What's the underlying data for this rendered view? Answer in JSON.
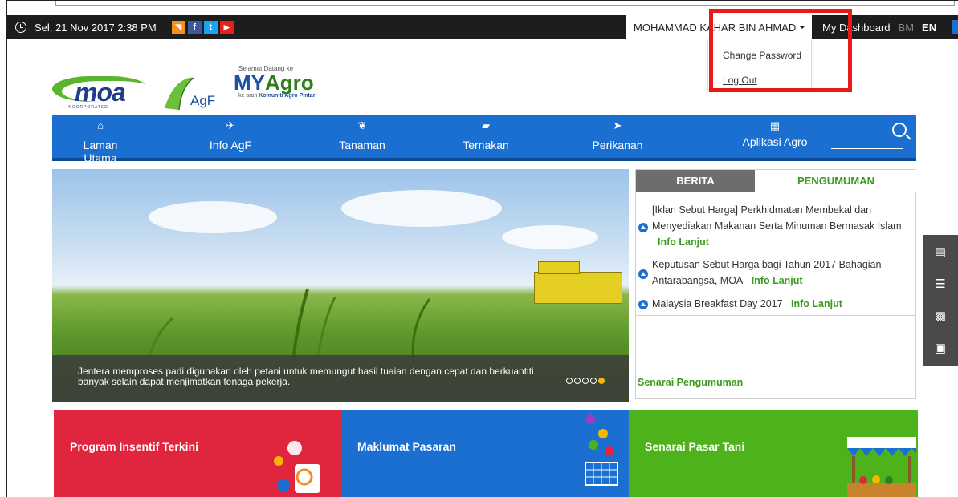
{
  "topbar": {
    "datetime": "Sel, 21 Nov 2017  2:38  PM",
    "social_icons": [
      "rss-icon",
      "facebook-icon",
      "twitter-icon",
      "youtube-icon"
    ],
    "user_name": "MOHAMMAD KAHAR BIN AHMAD",
    "dashboard": "My Dashboard",
    "lang_bm": "BM",
    "lang_en": "EN"
  },
  "user_menu": {
    "change_password": "Change Password",
    "log_out": "Log Out"
  },
  "logo": {
    "moa": "moa",
    "moa_sub": "INCORPORATED",
    "agf": "AgF",
    "welcome": "Selamat Datang ke",
    "brand_a": "MY",
    "brand_b": "Agro",
    "tagline_a": "ke arah ",
    "tagline_b": "Komuniti Agro Pintar"
  },
  "nav": {
    "items": [
      "Laman Utama",
      "Info AgF",
      "Tanaman",
      "Ternakan",
      "Perikanan",
      "Aplikasi Agro"
    ]
  },
  "hero": {
    "caption": "Jentera memproses padi digunakan oleh petani untuk memungut hasil tuaian dengan cepat dan berkuantiti banyak selain dapat menjimatkan tenaga pekerja.",
    "slides_total": 5,
    "active_slide": 5
  },
  "news": {
    "tab_berita": "BERITA",
    "tab_pengumuman": "PENGUMUMAN",
    "items": [
      {
        "text": "[Iklan Sebut Harga] Perkhidmatan Membekal dan Menyediakan Makanan Serta Minuman Bermasak Islam",
        "more": "Info Lanjut"
      },
      {
        "text": "Keputusan Sebut Harga bagi Tahun 2017 Bahagian Antarabangsa, MOA",
        "more": "Info Lanjut"
      },
      {
        "text": "Malaysia Breakfast Day 2017",
        "more": "Info Lanjut"
      }
    ],
    "list_link": "Senarai Pengumuman"
  },
  "side_tools": [
    "feedback-icon",
    "list-icon",
    "qr-code-icon",
    "news-icon"
  ],
  "cards": {
    "insentif": "Program Insentif Terkini",
    "pasaran": "Maklumat Pasaran",
    "pasar_tani": "Senarai Pasar Tani"
  },
  "colors": {
    "nav_blue": "#1a6fd0",
    "accent_green": "#3a9b1c",
    "card_red": "#e0263f",
    "card_green": "#4eb31b",
    "highlight_red": "#e61a1a"
  }
}
